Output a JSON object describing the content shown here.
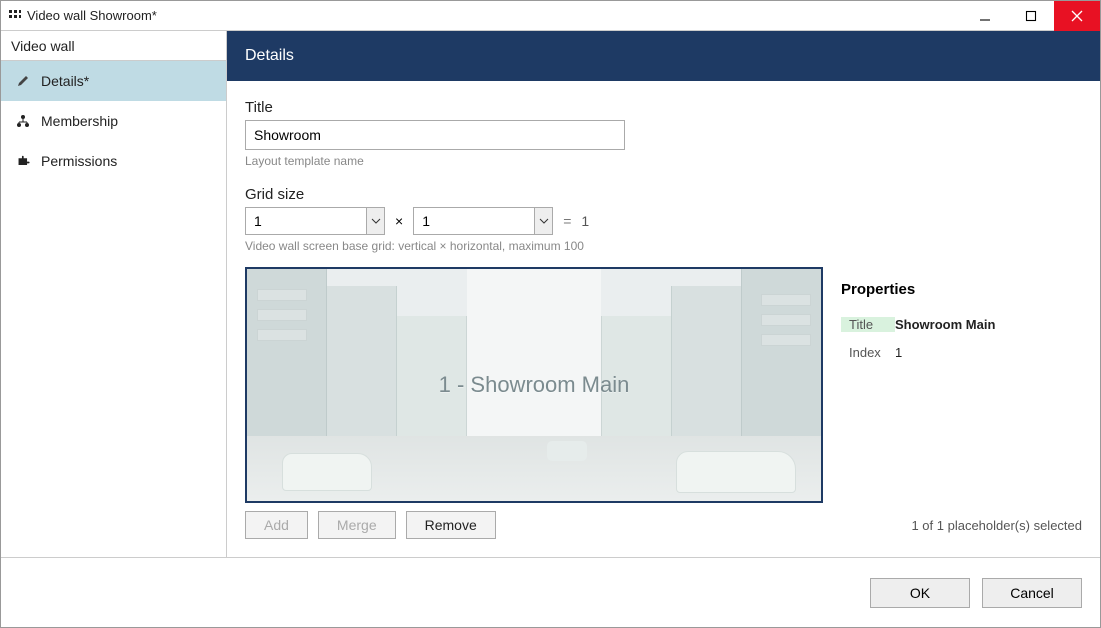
{
  "window": {
    "title": "Video wall Showroom*"
  },
  "sidebar": {
    "header": "Video wall",
    "items": [
      {
        "label": "Details*"
      },
      {
        "label": "Membership"
      },
      {
        "label": "Permissions"
      }
    ]
  },
  "banner": "Details",
  "form": {
    "title_label": "Title",
    "title_value": "Showroom",
    "title_hint": "Layout template name",
    "grid_label": "Grid size",
    "grid_v": "1",
    "grid_h": "1",
    "grid_times": "×",
    "grid_eq": "=",
    "grid_result": "1",
    "grid_hint": "Video wall screen base grid: vertical × horizontal, maximum 100"
  },
  "preview": {
    "overlay": "1 - Showroom Main"
  },
  "properties": {
    "heading": "Properties",
    "rows": [
      {
        "key": "Title",
        "val": "Showroom Main"
      },
      {
        "key": "Index",
        "val": "1"
      }
    ]
  },
  "buttons": {
    "add": "Add",
    "merge": "Merge",
    "remove": "Remove"
  },
  "selection_status": "1 of 1 placeholder(s) selected",
  "footer": {
    "ok": "OK",
    "cancel": "Cancel"
  }
}
